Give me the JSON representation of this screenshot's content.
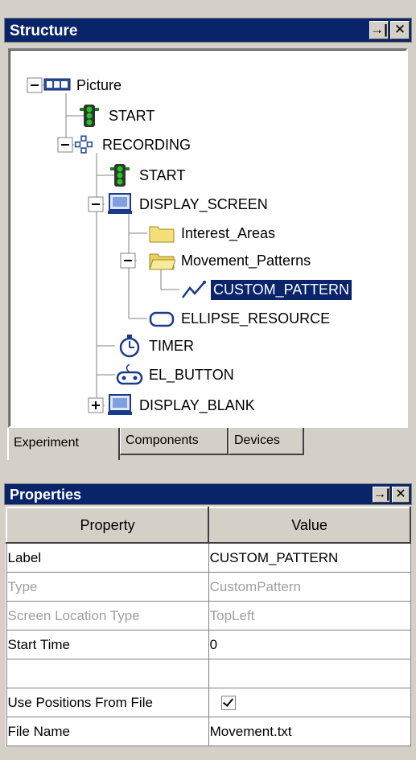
{
  "structure": {
    "title": "Structure",
    "pin_glyph": "→|",
    "close_glyph": "✕",
    "tree": [
      {
        "label": "Picture",
        "icon": "picture-icon",
        "expander": "minus"
      },
      {
        "label": "START",
        "icon": "traffic-light-icon"
      },
      {
        "label": "RECORDING",
        "icon": "recording-network-icon",
        "expander": "minus"
      },
      {
        "label": "START",
        "icon": "traffic-light-icon"
      },
      {
        "label": "DISPLAY_SCREEN",
        "icon": "monitor-icon",
        "expander": "minus"
      },
      {
        "label": "Interest_Areas",
        "icon": "folder-icon"
      },
      {
        "label": "Movement_Patterns",
        "icon": "folder-open-icon",
        "expander": "minus"
      },
      {
        "label": "CUSTOM_PATTERN",
        "icon": "custom-pattern-icon",
        "selected": true
      },
      {
        "label": "ELLIPSE_RESOURCE",
        "icon": "ellipse-icon"
      },
      {
        "label": "TIMER",
        "icon": "timer-icon"
      },
      {
        "label": "EL_BUTTON",
        "icon": "gamepad-icon"
      },
      {
        "label": "DISPLAY_BLANK",
        "icon": "monitor-icon",
        "expander": "plus"
      }
    ],
    "tabs": [
      {
        "label": "Experiment",
        "active": true
      },
      {
        "label": "Components"
      },
      {
        "label": "Devices"
      }
    ]
  },
  "properties": {
    "title": "Properties",
    "pin_glyph": "→|",
    "close_glyph": "✕",
    "columns": [
      "Property",
      "Value"
    ],
    "rows": [
      {
        "property": "Label",
        "value": "CUSTOM_PATTERN",
        "disabled": false
      },
      {
        "property": "Type",
        "value": "CustomPattern",
        "disabled": true
      },
      {
        "property": "Screen Location Type",
        "value": "TopLeft",
        "disabled": true
      },
      {
        "property": "Start Time",
        "value": "0",
        "disabled": false
      },
      {
        "property": "",
        "value": "",
        "disabled": false
      },
      {
        "property": "Use Positions From File",
        "value": "",
        "checkbox": true,
        "checked": true
      },
      {
        "property": "File Name",
        "value": "Movement.txt",
        "disabled": false
      }
    ]
  },
  "colors": {
    "titlebar": "#0a246a",
    "selection": "#0a246a",
    "panel": "#d4d0c8"
  }
}
